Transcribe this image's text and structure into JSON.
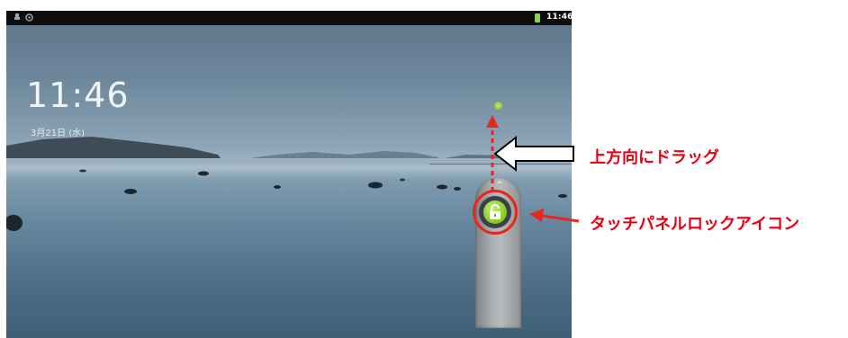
{
  "status_bar": {
    "time": "11:46",
    "icons": [
      "usb-icon",
      "notification-icon",
      "battery-icon"
    ],
    "battery_color": "#8fd14f"
  },
  "lockscreen": {
    "time": "11:46",
    "date": "3月21日 (水)",
    "lock_icon": "unlock-icon",
    "lock_color": "#8ccc2a"
  },
  "annotations": {
    "drag_label": "上方向にドラッグ",
    "lock_label": "タッチパネルロックアイコン",
    "color": "#e60012"
  }
}
